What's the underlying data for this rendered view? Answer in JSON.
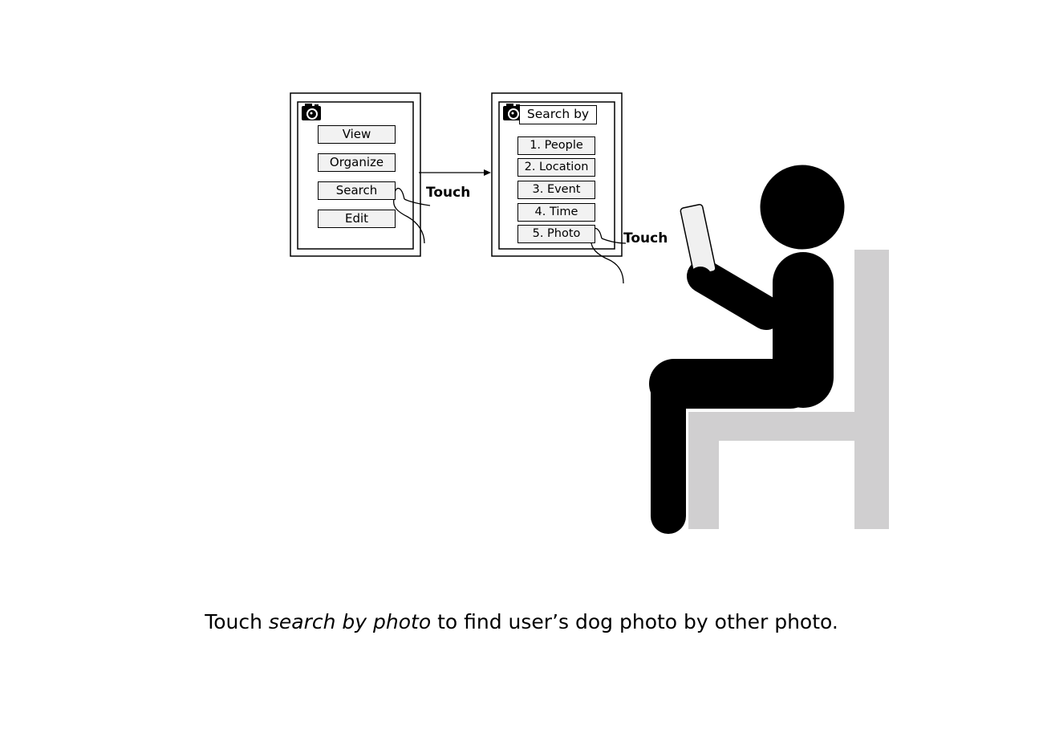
{
  "screen1": {
    "buttons": [
      "View",
      "Organize",
      "Search",
      "Edit"
    ],
    "touch_label": "Touch"
  },
  "screen2": {
    "title": "Search by",
    "options": [
      "1. People",
      "2. Location",
      "3. Event",
      "4. Time",
      "5. Photo"
    ],
    "touch_label": "Touch"
  },
  "caption": {
    "prefix": "Touch ",
    "emphasis": "search by photo",
    "suffix": " to find user’s dog photo by other photo."
  },
  "colors": {
    "figure": "#000000",
    "chair": "#d0cfd0",
    "button_fill": "#f2f2f2",
    "phone": "#f0f0f0"
  }
}
